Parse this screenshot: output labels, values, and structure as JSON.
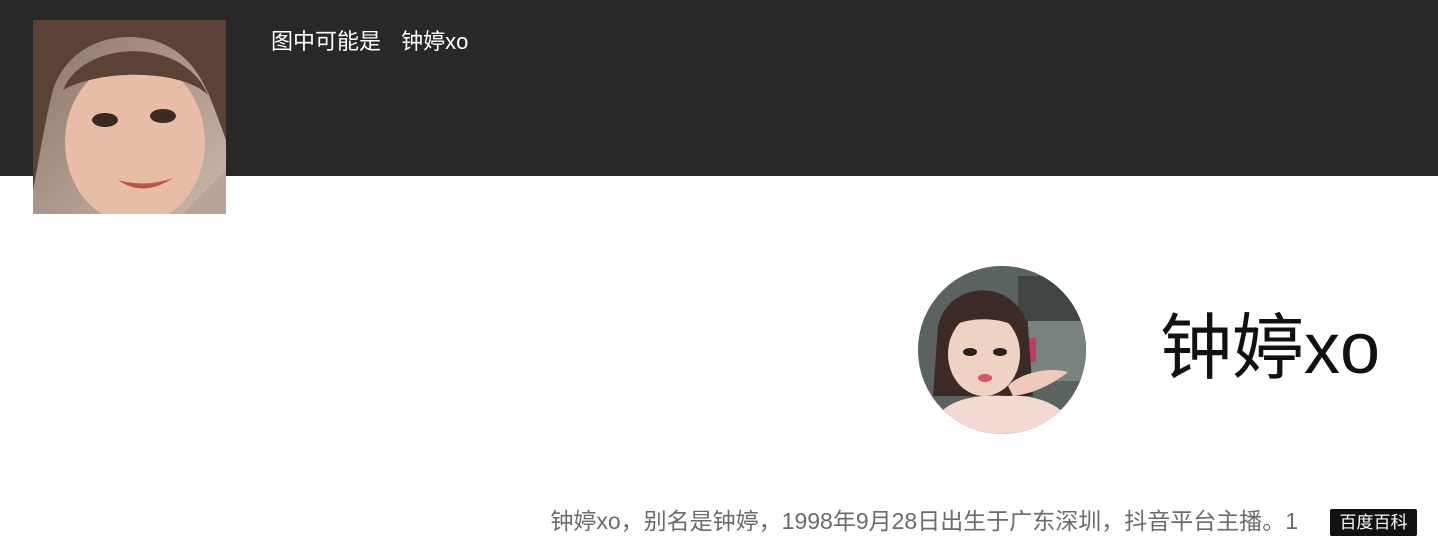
{
  "header": {
    "thumbnail_icon": "person-photo",
    "caption_prefix": "图中可能是",
    "caption_name": "钟婷xo"
  },
  "entity": {
    "avatar_icon": "person-photo",
    "name": "钟婷xo",
    "description": "钟婷xo，别名是钟婷，1998年9月28日出生于广东深圳，抖音平台主播。1",
    "source": "百度百科"
  },
  "colors": {
    "header_background": "#282828",
    "page_background": "#ffffff",
    "description_text": "#6b6b6b",
    "badge_background": "#111111"
  }
}
